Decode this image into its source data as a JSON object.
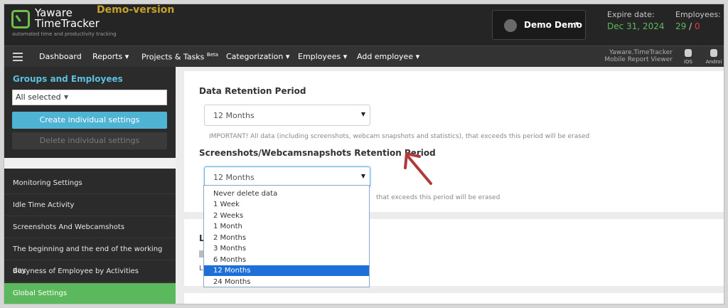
{
  "header": {
    "logo_line1": "Yaware",
    "logo_line2": "TimeTracker",
    "logo_sub": "automated time and productivity tracking",
    "demo_label": "Demo-version",
    "user_name": "Demo Demo",
    "expire_label": "Expire date:",
    "expire_date": "Dec 31, 2024",
    "employees_label": "Employees:",
    "employees_current": "29",
    "employees_sep": "/",
    "employees_limit": "0"
  },
  "nav": {
    "items": [
      "Dashboard",
      "Reports",
      "Projects & Tasks",
      "Categorization",
      "Employees",
      "Add employee"
    ],
    "beta": "Beta",
    "mobile_line1": "Yaware.TimeTracker",
    "mobile_line2": "Mobile Report Viewer",
    "ios": "iOS",
    "android": "Androi"
  },
  "sidebar": {
    "title": "Groups and Employees",
    "selector_value": "All selected",
    "create_label": "Create individual settings",
    "delete_label": "Delete individual settings",
    "items": [
      "Monitoring Settings",
      "Idle Time Activity",
      "Screenshots And Webcamshots",
      "The beginning and the end of the working day",
      "Busyness of Employee by Activities",
      "Global Settings"
    ],
    "active_index": 5
  },
  "main": {
    "data_retention": {
      "title": "Data Retention Period",
      "value": "12 Months",
      "note": "IMPORTANT! All data (including screenshots, webcam snapshots and statistics), that exceeds this period will be erased"
    },
    "screenshot_retention": {
      "title": "Screenshots/Webcamsnapshots Retention Period",
      "value": "12 Months",
      "note_partial": "that exceeds this period will be erased"
    },
    "panel2": {
      "label_partial": "L",
      "label2_partial": "L"
    },
    "dropdown_options": [
      "Never delete data",
      "1 Week",
      "2 Weeks",
      "1 Month",
      "2 Months",
      "3 Months",
      "6 Months",
      "12 Months",
      "24 Months"
    ],
    "dropdown_selected_index": 7
  },
  "colors": {
    "accent_green": "#5cb85c",
    "accent_blue": "#4fb3d4",
    "selected_blue": "#1e70d8",
    "arrow_red": "#b03a3a"
  }
}
